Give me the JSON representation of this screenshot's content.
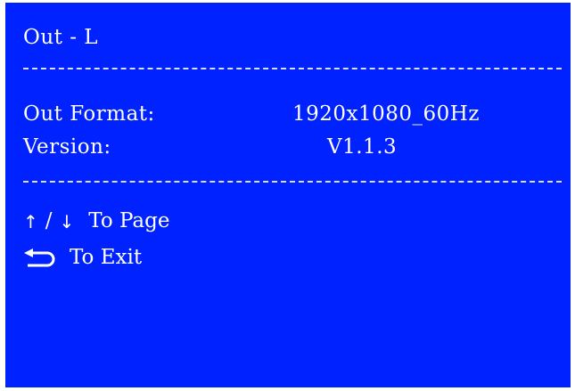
{
  "screen": {
    "title": "Out - L",
    "background_color": "#0022ff",
    "text_color": "#ffffff"
  },
  "info": {
    "out_format_label": "Out Format:",
    "out_format_value": "1920x1080_60Hz",
    "version_label": "Version:",
    "version_value": "V1.1.3"
  },
  "nav": {
    "up_arrow": "↑",
    "separator": "/",
    "down_arrow": "↓",
    "page_hint": "To Page",
    "return_icon": "return-arrow-icon",
    "exit_hint": "To Exit"
  }
}
